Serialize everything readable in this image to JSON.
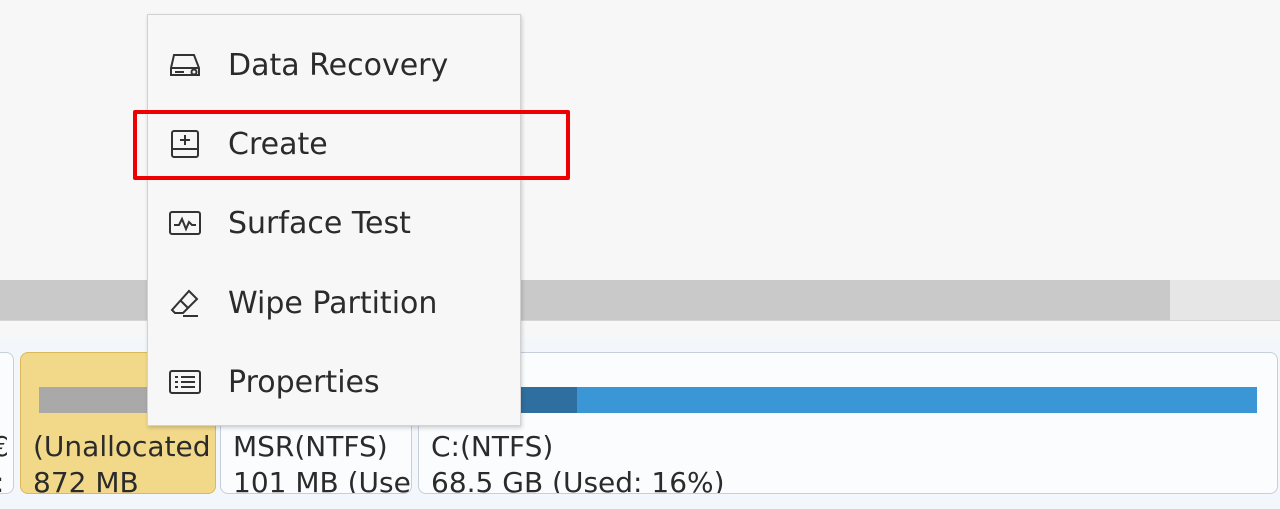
{
  "context_menu": {
    "items": [
      {
        "label": "Data Recovery",
        "icon": "data-recovery-icon"
      },
      {
        "label": "Create",
        "icon": "create-partition-icon"
      },
      {
        "label": "Surface Test",
        "icon": "surface-test-icon"
      },
      {
        "label": "Wipe Partition",
        "icon": "wipe-eraser-icon"
      },
      {
        "label": "Properties",
        "icon": "properties-list-icon"
      }
    ]
  },
  "highlight": {
    "target": "Create",
    "color": "#ee0000"
  },
  "disk_map": {
    "partitions": [
      {
        "line1": "(Unallocated",
        "line2": "872 MB",
        "color": "#f2d98a"
      },
      {
        "line1": "MSR(NTFS)",
        "line2": "101 MB (Used",
        "color": "#fbfcfe"
      },
      {
        "line1": "C:(NTFS)",
        "line2": "68.5 GB (Used: 16%)",
        "used_percent": 16,
        "color": "#3a96d4"
      }
    ],
    "left_partial": {
      "line1": "€",
      "line2": ":"
    }
  }
}
